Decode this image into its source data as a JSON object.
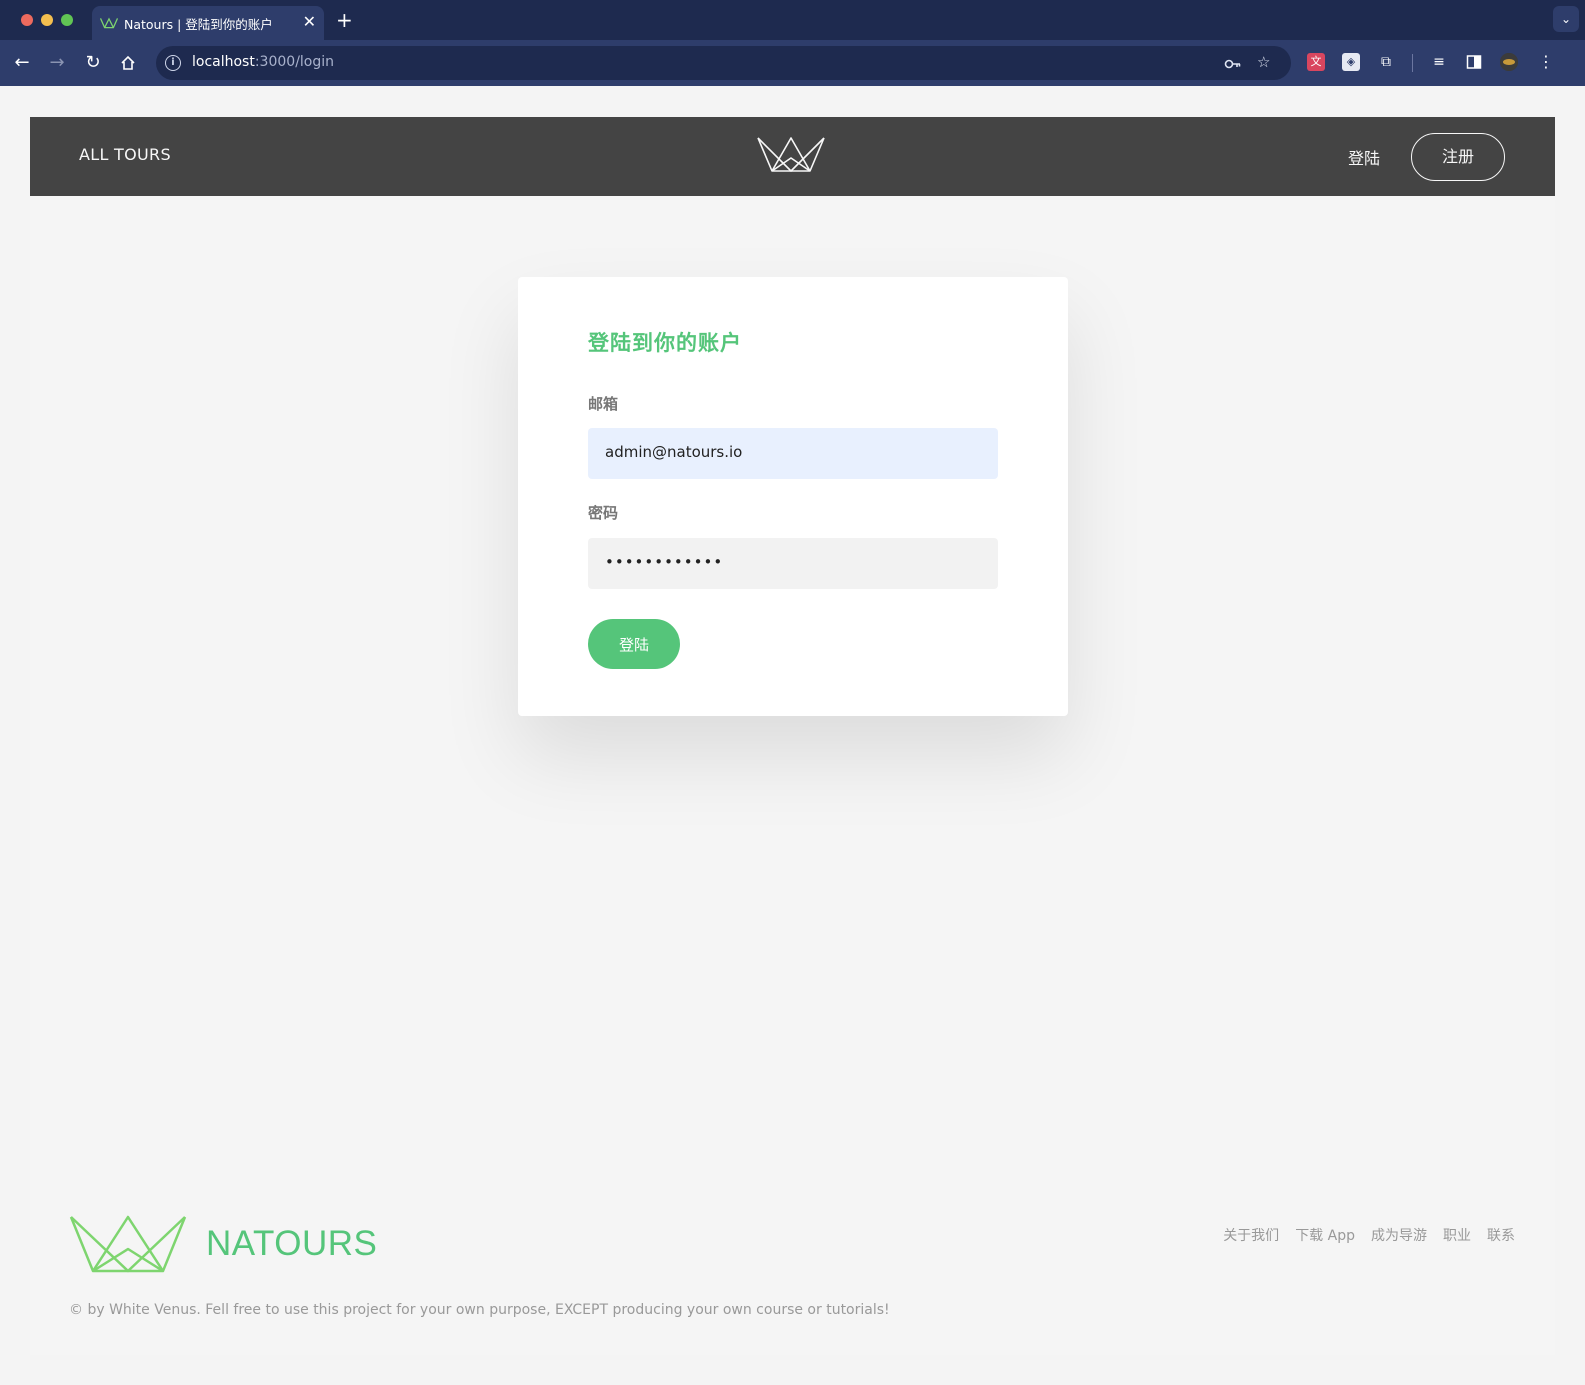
{
  "browser": {
    "tab_title": "Natours | 登陆到你的账户",
    "url_host": "localhost",
    "url_path": ":3000/login",
    "new_tab_glyph": "+",
    "close_glyph": "✕"
  },
  "header": {
    "all_tours": "ALL TOURS",
    "login": "登陆",
    "signup": "注册"
  },
  "login_form": {
    "title": "登陆到你的账户",
    "email_label": "邮箱",
    "email_value": "admin@natours.io",
    "password_label": "密码",
    "password_value": "••••••••••••",
    "submit_label": "登陆"
  },
  "footer": {
    "brand": "NATOURS",
    "links": [
      "关于我们",
      "下载 App",
      "成为导游",
      "职业",
      "联系"
    ],
    "copyright": "© by White Venus. Fell free to use this project for your own purpose, EXCEPT producing your own course or tutorials!"
  },
  "colors": {
    "brand_green": "#55c57a",
    "header_bg": "#444444",
    "chrome_dark": "#1e2a4f",
    "chrome_mid": "#2e3d6b"
  }
}
